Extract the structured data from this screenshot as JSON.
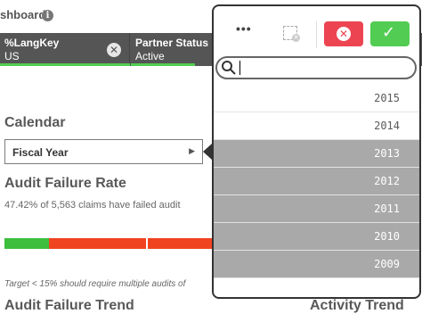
{
  "header": {
    "app_title": "shboard",
    "info_icon": "info-icon"
  },
  "selections": [
    {
      "field": "%LangKey",
      "value": "US",
      "icon": "close-icon"
    },
    {
      "field": "Partner Status",
      "value": "Active"
    }
  ],
  "calendar": {
    "title": "Calendar",
    "dropdown_label": "Fiscal Year",
    "dropdown_icon": "triangle-right-icon"
  },
  "audit": {
    "title": "Audit Failure Rate",
    "summary": "47.42% of 5,563 claims have failed audit",
    "gauge": {
      "value_percent": 47.42,
      "target_percent": 15,
      "colors": {
        "good": "#3DBE3D",
        "bad": "#F0431F"
      }
    },
    "note": "Target < 15% should require multiple audits of"
  },
  "bottom": {
    "left_title": "Audit Failure Trend",
    "right_title": "Activity Trend"
  },
  "listbox": {
    "toolbar": {
      "more_label": "•••",
      "clear_icon": "clear-selection-icon",
      "cancel_icon": "cancel-icon",
      "confirm_icon": "check-icon"
    },
    "search": {
      "placeholder": "",
      "value": ""
    },
    "items": [
      {
        "label": "2015",
        "state": "possible"
      },
      {
        "label": "2014",
        "state": "possible"
      },
      {
        "label": "2013",
        "state": "excluded"
      },
      {
        "label": "2012",
        "state": "excluded"
      },
      {
        "label": "2011",
        "state": "excluded"
      },
      {
        "label": "2010",
        "state": "excluded"
      },
      {
        "label": "2009",
        "state": "excluded"
      }
    ],
    "colors": {
      "excluded": "#A9A9A9",
      "possible": "#FFFFFF",
      "cancel": "#ED4452",
      "confirm": "#52CC52"
    }
  }
}
